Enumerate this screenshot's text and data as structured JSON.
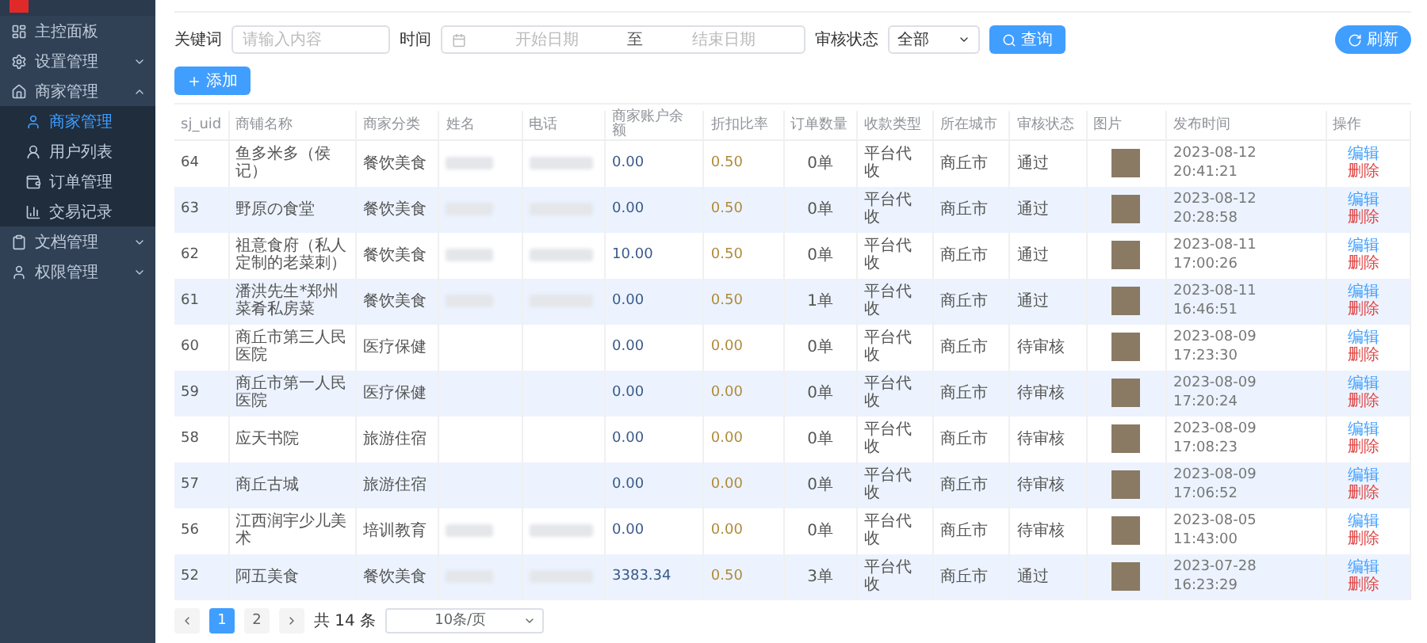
{
  "sidebar": {
    "items": [
      {
        "label": "主控面板",
        "selected": false
      },
      {
        "label": "设置管理",
        "expanded": false,
        "selected": false
      },
      {
        "label": "商家管理",
        "expanded": true,
        "selected": false,
        "children": [
          {
            "label": "商家管理",
            "selected": true
          },
          {
            "label": "用户列表",
            "selected": false
          },
          {
            "label": "订单管理",
            "selected": false
          },
          {
            "label": "交易记录",
            "selected": false
          }
        ]
      },
      {
        "label": "文档管理",
        "expanded": false,
        "selected": false
      },
      {
        "label": "权限管理",
        "expanded": false,
        "selected": false
      }
    ]
  },
  "filters": {
    "keyword_label": "关键词",
    "keyword_placeholder": "请输入内容",
    "time_label": "时间",
    "start_placeholder": "开始日期",
    "separator": "至",
    "end_placeholder": "结束日期",
    "status_label": "审核状态",
    "status_value": "全部",
    "search_button": "查询",
    "refresh_button": "刷新"
  },
  "add_button": "添加",
  "table": {
    "columns": [
      "sj_uid",
      "商铺名称",
      "商家分类",
      "姓名",
      "电话",
      "商家账户余额",
      "折扣比率",
      "订单数量",
      "收款类型",
      "所在城市",
      "审核状态",
      "图片",
      "发布时间",
      "操作"
    ],
    "rows": [
      {
        "id": "64",
        "name": "鱼多米多（侯记）",
        "category": "餐饮美食",
        "balance": "0.00",
        "discount": "0.50",
        "orders": "0单",
        "pay_type": "平台代收",
        "city": "商丘市",
        "status": "通过",
        "time": "2023-08-12 20:41:21",
        "edit": "编辑",
        "delete": "删除"
      },
      {
        "id": "63",
        "name": "野原の食堂",
        "category": "餐饮美食",
        "balance": "0.00",
        "discount": "0.50",
        "orders": "0单",
        "pay_type": "平台代收",
        "city": "商丘市",
        "status": "通过",
        "time": "2023-08-12 20:28:58",
        "edit": "编辑",
        "delete": "删除"
      },
      {
        "id": "62",
        "name": "祖意食府（私人定制的老菜刺）",
        "category": "餐饮美食",
        "balance": "10.00",
        "discount": "0.50",
        "orders": "0单",
        "pay_type": "平台代收",
        "city": "商丘市",
        "status": "通过",
        "time": "2023-08-11 17:00:26",
        "edit": "编辑",
        "delete": "删除"
      },
      {
        "id": "61",
        "name": "潘洪先生*郑州菜肴私房菜",
        "category": "餐饮美食",
        "balance": "0.00",
        "discount": "0.50",
        "orders": "1单",
        "pay_type": "平台代收",
        "city": "商丘市",
        "status": "通过",
        "time": "2023-08-11 16:46:51",
        "edit": "编辑",
        "delete": "删除"
      },
      {
        "id": "60",
        "name": "商丘市第三人民医院",
        "category": "医疗保健",
        "balance": "0.00",
        "discount": "0.00",
        "orders": "0单",
        "pay_type": "平台代收",
        "city": "商丘市",
        "status": "待审核",
        "time": "2023-08-09 17:23:30",
        "edit": "编辑",
        "delete": "删除"
      },
      {
        "id": "59",
        "name": "商丘市第一人民医院",
        "category": "医疗保健",
        "balance": "0.00",
        "discount": "0.00",
        "orders": "0单",
        "pay_type": "平台代收",
        "city": "商丘市",
        "status": "待审核",
        "time": "2023-08-09 17:20:24",
        "edit": "编辑",
        "delete": "删除"
      },
      {
        "id": "58",
        "name": "应天书院",
        "category": "旅游住宿",
        "balance": "0.00",
        "discount": "0.00",
        "orders": "0单",
        "pay_type": "平台代收",
        "city": "商丘市",
        "status": "待审核",
        "time": "2023-08-09 17:08:23",
        "edit": "编辑",
        "delete": "删除"
      },
      {
        "id": "57",
        "name": "商丘古城",
        "category": "旅游住宿",
        "balance": "0.00",
        "discount": "0.00",
        "orders": "0单",
        "pay_type": "平台代收",
        "city": "商丘市",
        "status": "待审核",
        "time": "2023-08-09 17:06:52",
        "edit": "编辑",
        "delete": "删除"
      },
      {
        "id": "56",
        "name": "江西润宇少儿美术",
        "category": "培训教育",
        "balance": "0.00",
        "discount": "0.00",
        "orders": "0单",
        "pay_type": "平台代收",
        "city": "商丘市",
        "status": "待审核",
        "time": "2023-08-05 11:43:00",
        "edit": "编辑",
        "delete": "删除"
      },
      {
        "id": "52",
        "name": "阿五美食",
        "category": "餐饮美食",
        "balance": "3383.34",
        "discount": "0.50",
        "orders": "3单",
        "pay_type": "平台代收",
        "city": "商丘市",
        "status": "通过",
        "time": "2023-07-28 16:23:29",
        "edit": "编辑",
        "delete": "删除"
      }
    ]
  },
  "pagination": {
    "pages": [
      {
        "label": "1",
        "selected": true
      },
      {
        "label": "2",
        "selected": false
      }
    ],
    "total": "共 14 条",
    "page_size": "10条/页"
  }
}
